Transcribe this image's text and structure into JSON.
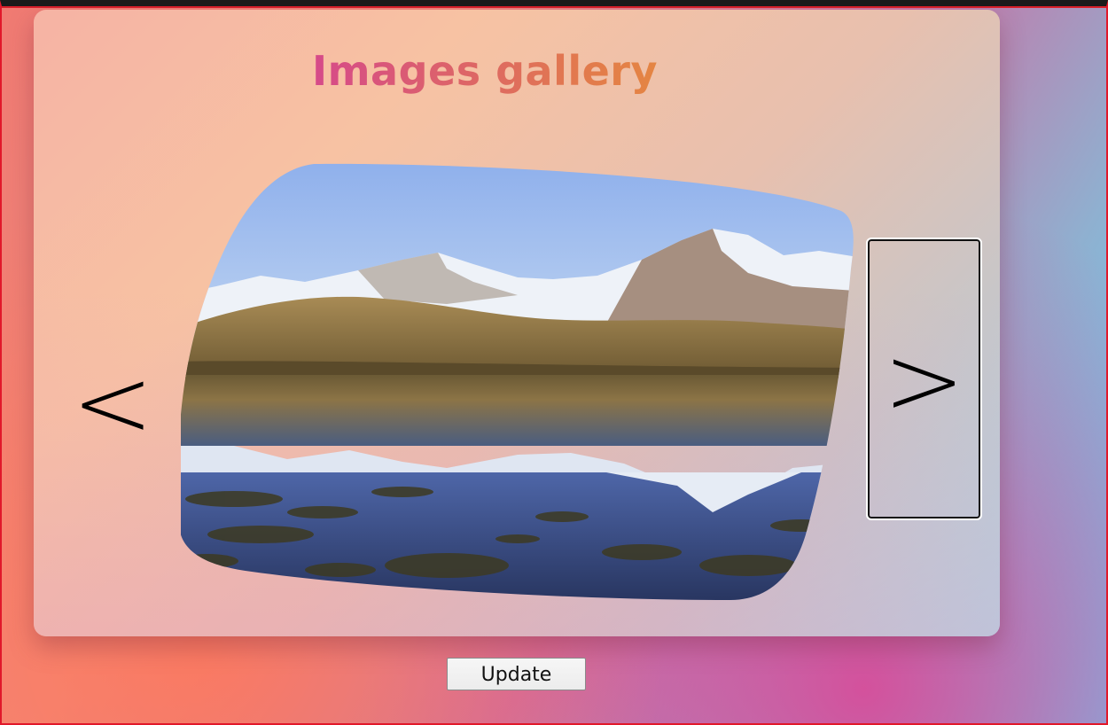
{
  "gallery": {
    "title": "Images gallery",
    "prev_label": "<",
    "next_label": ">",
    "image_alt": "Snow-capped mountains reflected in a calm lake"
  },
  "actions": {
    "update_label": "Update"
  },
  "colors": {
    "title_gradient": [
      "#c21ee0",
      "#d5468e",
      "#e27a4d",
      "#efb41a"
    ],
    "window_border": "#e1182a",
    "next_button_border": "#111111"
  }
}
